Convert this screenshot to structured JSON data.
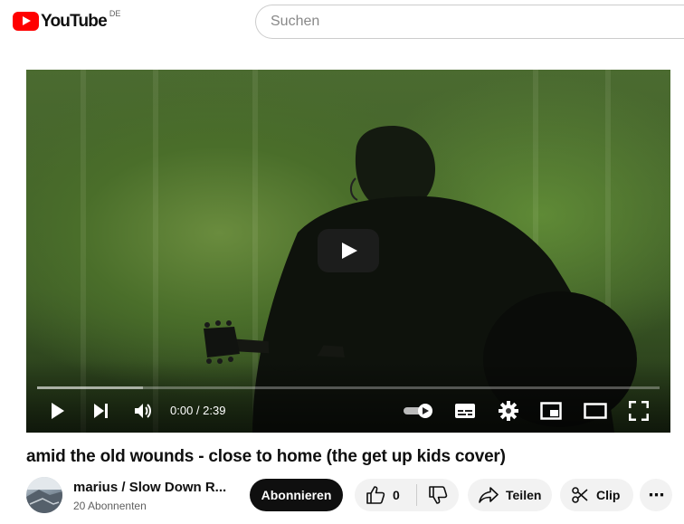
{
  "header": {
    "logo_text": "YouTube",
    "region": "DE",
    "search_placeholder": "Suchen"
  },
  "player": {
    "time": "0:00 / 2:39",
    "progress_loaded": 0.17,
    "icons": [
      "play-icon",
      "next-icon",
      "volume-icon",
      "autoplay-toggle-icon",
      "subtitles-icon",
      "settings-icon",
      "miniplayer-icon",
      "theater-icon",
      "fullscreen-icon"
    ]
  },
  "video": {
    "title": "amid the old wounds - close to home (the get up kids cover)"
  },
  "channel": {
    "name": "marius / Slow Down R...",
    "subscribers": "20 Abonnenten",
    "subscribe_label": "Abonnieren"
  },
  "actions": {
    "like_count": "0",
    "share_label": "Teilen",
    "clip_label": "Clip",
    "more_label": "⋯"
  },
  "colors": {
    "brand_red": "#ff0000",
    "text": "#0f0f0f",
    "pill_bg": "#f2f2f2"
  }
}
